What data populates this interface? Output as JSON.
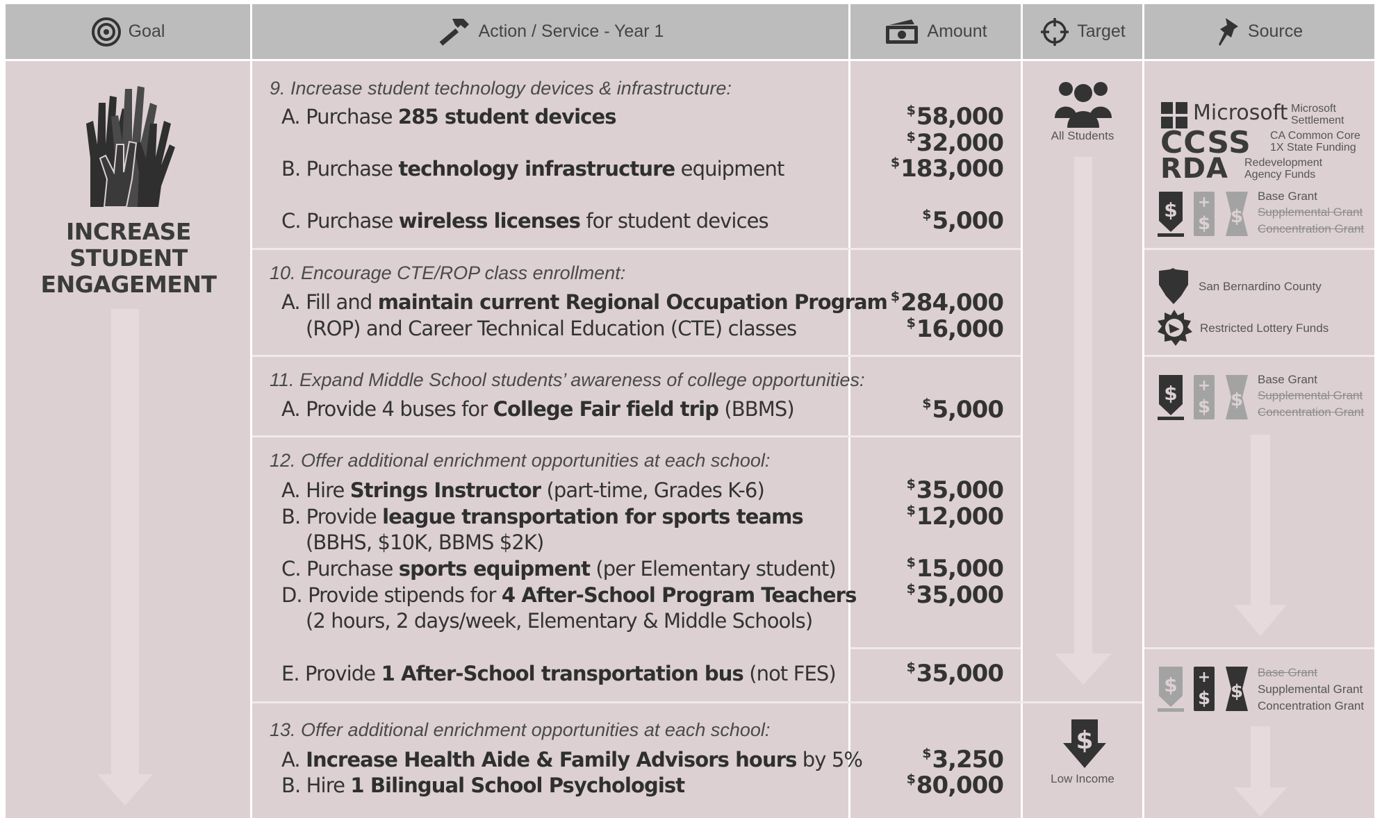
{
  "header": {
    "goal": "Goal",
    "action": "Action / Service - Year 1",
    "amount": "Amount",
    "target": "Target",
    "source": "Source"
  },
  "goal": {
    "title": "INCREASE STUDENT ENGAGEMENT"
  },
  "sections": {
    "s9": {
      "intro": "9. Increase student technology devices & infrastructure:",
      "a_pre": "A. Purchase ",
      "a_bold": "285 student devices",
      "a_post": "",
      "b_pre": "B. Purchase ",
      "b_bold": "technology infrastructure",
      "b_post": " equipment",
      "c_pre": "C. Purchase ",
      "c_bold": "wireless licenses",
      "c_post": " for student devices",
      "amounts": [
        "58,000",
        "32,000",
        "183,000",
        "5,000"
      ]
    },
    "s10": {
      "intro": "10. Encourage CTE/ROP class enrollment:",
      "a_pre": "A. Fill and ",
      "a_bold": "maintain current Regional Occupation Program",
      "a_post": "",
      "a_line2": "(ROP) and Career Technical Education (CTE) classes",
      "amounts": [
        "284,000",
        "16,000"
      ]
    },
    "s11": {
      "intro": "11. Expand Middle School students’ awareness of college opportunities:",
      "a_pre": "A. Provide 4 buses for ",
      "a_bold": "College Fair field trip",
      "a_post": " (BBMS)",
      "amounts": [
        "5,000"
      ]
    },
    "s12": {
      "intro": "12. Offer additional enrichment opportunities at each school:",
      "a_pre": "A. Hire ",
      "a_bold": "Strings Instructor",
      "a_post": " (part-time, Grades K-6)",
      "b_pre": "B. Provide ",
      "b_bold": "league transportation for sports teams",
      "b_post": "",
      "b_line2": "(BBHS, $10K, BBMS $2K)",
      "c_pre": "C. Purchase ",
      "c_bold": "sports equipment",
      "c_post": " (per Elementary student)",
      "d_pre": "D. Provide stipends for ",
      "d_bold": "4 After-School Program Teachers",
      "d_post": "",
      "d_line2": "(2 hours, 2 days/week, Elementary & Middle Schools)",
      "e_pre": "E. Provide ",
      "e_bold": "1 After-School transportation bus",
      "e_post": " (not FES)",
      "amounts": [
        "35,000",
        "12,000",
        "15,000",
        "35,000",
        "35,000"
      ]
    },
    "s13": {
      "intro": "13. Offer additional enrichment opportunities at each school:",
      "a_pre": "A. ",
      "a_bold": "Increase Health Aide & Family Advisors hours",
      "a_post": " by 5%",
      "b_pre": "B. Hire ",
      "b_bold": "1 Bilingual School Psychologist",
      "b_post": "",
      "amounts": [
        "3,250",
        "80,000"
      ]
    }
  },
  "currency_symbol": "$",
  "targets": {
    "all": "All Students",
    "low": "Low Income"
  },
  "sources": {
    "microsoft": {
      "brand": "Microsoft",
      "label": "Microsoft Settlement"
    },
    "ccss": {
      "brand": "CCSS",
      "label": "CA Common Core 1X State Funding"
    },
    "rda": {
      "brand": "RDA",
      "label": "Redevelopment Agency Funds"
    },
    "grants": [
      "Base Grant",
      "Supplemental Grant",
      "Concentration Grant"
    ],
    "county": "San Bernardino County",
    "lottery": "Restricted Lottery Funds"
  },
  "colors": {
    "header_bg": "#bdbcbd",
    "body_bg": "#dcd0d2",
    "divider": "#f0eaeb",
    "text": "#333333"
  }
}
